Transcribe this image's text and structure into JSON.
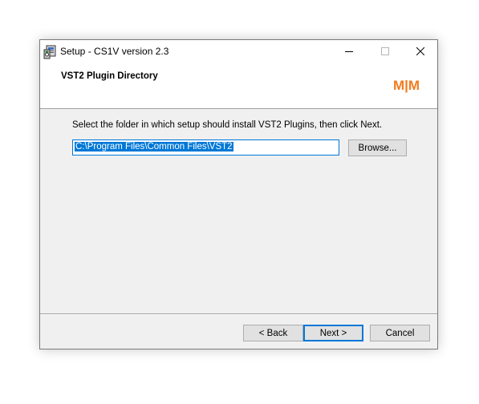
{
  "window": {
    "title": "Setup - CS1V version 2.3",
    "app_icon": "setup-installer-icon"
  },
  "controls": {
    "minimize_icon": "minimize-icon",
    "maximize_icon": "maximize-icon",
    "close_icon": "close-icon"
  },
  "header": {
    "title": "VST2 Plugin Directory",
    "logo_text": "M|M",
    "logo_color": "#f07c1e"
  },
  "main": {
    "instructions": "Select the folder in which setup should install VST2 Plugins, then click Next.",
    "path_value": "C:\\Program Files\\Common Files\\VST2",
    "browse_label": "Browse..."
  },
  "footer": {
    "back_label": "< Back",
    "next_label": "Next >",
    "cancel_label": "Cancel"
  },
  "colors": {
    "accent": "#0078d7",
    "button_face": "#e1e1e1",
    "dialog_bg": "#f0f0f0"
  }
}
